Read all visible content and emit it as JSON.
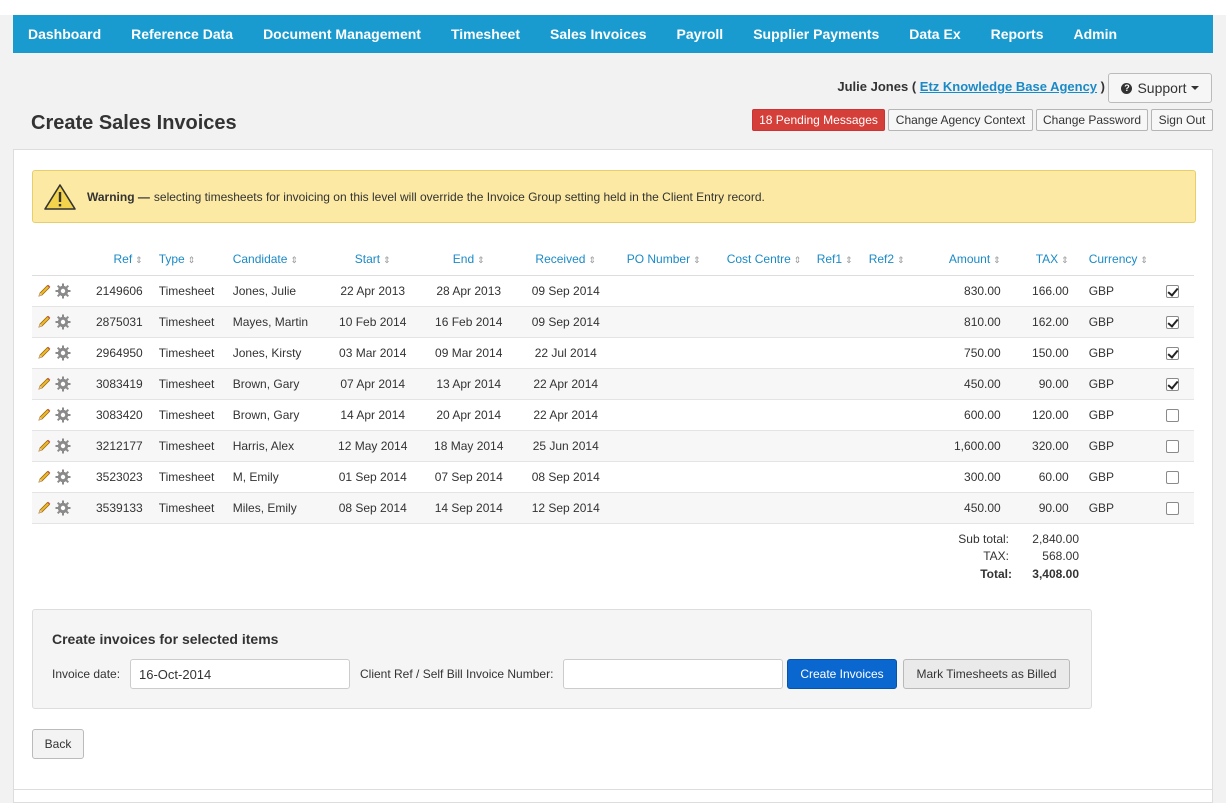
{
  "nav": [
    "Dashboard",
    "Reference Data",
    "Document Management",
    "Timesheet",
    "Sales Invoices",
    "Payroll",
    "Supplier Payments",
    "Data Ex",
    "Reports",
    "Admin"
  ],
  "header": {
    "user_name": "Julie Jones",
    "open_paren": "(",
    "agency": "Etz Knowledge Base Agency",
    "close_paren": ")",
    "support_label": "Support",
    "pending_label": "18 Pending Messages",
    "change_agency_label": "Change Agency Context",
    "change_password_label": "Change Password",
    "sign_out_label": "Sign Out"
  },
  "page": {
    "title": "Create Sales Invoices"
  },
  "warning": {
    "bold": "Warning —",
    "text": "selecting timesheets for invoicing on this level will override the Invoice Group setting held in the Client Entry record."
  },
  "table": {
    "columns": [
      "Ref",
      "Type",
      "Candidate",
      "Start",
      "End",
      "Received",
      "PO Number",
      "Cost Centre",
      "Ref1",
      "Ref2",
      "Amount",
      "TAX",
      "Currency"
    ],
    "sort_glyph": "⇕",
    "rows": [
      {
        "ref": "2149606",
        "type": "Timesheet",
        "candidate": "Jones, Julie",
        "start": "22 Apr 2013",
        "end": "28 Apr 2013",
        "received": "09 Sep 2014",
        "po": "",
        "cost_centre": "",
        "ref1": "",
        "ref2": "",
        "amount": "830.00",
        "tax": "166.00",
        "currency": "GBP",
        "checked": true
      },
      {
        "ref": "2875031",
        "type": "Timesheet",
        "candidate": "Mayes, Martin",
        "start": "10 Feb 2014",
        "end": "16 Feb 2014",
        "received": "09 Sep 2014",
        "po": "",
        "cost_centre": "",
        "ref1": "",
        "ref2": "",
        "amount": "810.00",
        "tax": "162.00",
        "currency": "GBP",
        "checked": true
      },
      {
        "ref": "2964950",
        "type": "Timesheet",
        "candidate": "Jones, Kirsty",
        "start": "03 Mar 2014",
        "end": "09 Mar 2014",
        "received": "22 Jul 2014",
        "po": "",
        "cost_centre": "",
        "ref1": "",
        "ref2": "",
        "amount": "750.00",
        "tax": "150.00",
        "currency": "GBP",
        "checked": true
      },
      {
        "ref": "3083419",
        "type": "Timesheet",
        "candidate": "Brown, Gary",
        "start": "07 Apr 2014",
        "end": "13 Apr 2014",
        "received": "22 Apr 2014",
        "po": "",
        "cost_centre": "",
        "ref1": "",
        "ref2": "",
        "amount": "450.00",
        "tax": "90.00",
        "currency": "GBP",
        "checked": true
      },
      {
        "ref": "3083420",
        "type": "Timesheet",
        "candidate": "Brown, Gary",
        "start": "14 Apr 2014",
        "end": "20 Apr 2014",
        "received": "22 Apr 2014",
        "po": "",
        "cost_centre": "",
        "ref1": "",
        "ref2": "",
        "amount": "600.00",
        "tax": "120.00",
        "currency": "GBP",
        "checked": false
      },
      {
        "ref": "3212177",
        "type": "Timesheet",
        "candidate": "Harris, Alex",
        "start": "12 May 2014",
        "end": "18 May 2014",
        "received": "25 Jun 2014",
        "po": "",
        "cost_centre": "",
        "ref1": "",
        "ref2": "",
        "amount": "1,600.00",
        "tax": "320.00",
        "currency": "GBP",
        "checked": false
      },
      {
        "ref": "3523023",
        "type": "Timesheet",
        "candidate": "M, Emily",
        "start": "01 Sep 2014",
        "end": "07 Sep 2014",
        "received": "08 Sep 2014",
        "po": "",
        "cost_centre": "",
        "ref1": "",
        "ref2": "",
        "amount": "300.00",
        "tax": "60.00",
        "currency": "GBP",
        "checked": false
      },
      {
        "ref": "3539133",
        "type": "Timesheet",
        "candidate": "Miles, Emily",
        "start": "08 Sep 2014",
        "end": "14 Sep 2014",
        "received": "12 Sep 2014",
        "po": "",
        "cost_centre": "",
        "ref1": "",
        "ref2": "",
        "amount": "450.00",
        "tax": "90.00",
        "currency": "GBP",
        "checked": false
      }
    ]
  },
  "totals": {
    "subtotal_label": "Sub total:",
    "subtotal": "2,840.00",
    "tax_label": "TAX:",
    "tax": "568.00",
    "total_label": "Total:",
    "total": "3,408.00"
  },
  "create": {
    "heading": "Create invoices for selected items",
    "invoice_date_label": "Invoice date:",
    "invoice_date_value": "16-Oct-2014",
    "client_ref_label": "Client Ref / Self Bill Invoice Number:",
    "client_ref_value": "",
    "create_button": "Create Invoices",
    "mark_button": "Mark Timesheets as Billed"
  },
  "back_label": "Back",
  "colors": {
    "nav": "#1a9bd0",
    "link": "#1a8ac7",
    "danger": "#d43f3a",
    "primary": "#0a67cf",
    "warning_bg": "#fbe9a4"
  }
}
